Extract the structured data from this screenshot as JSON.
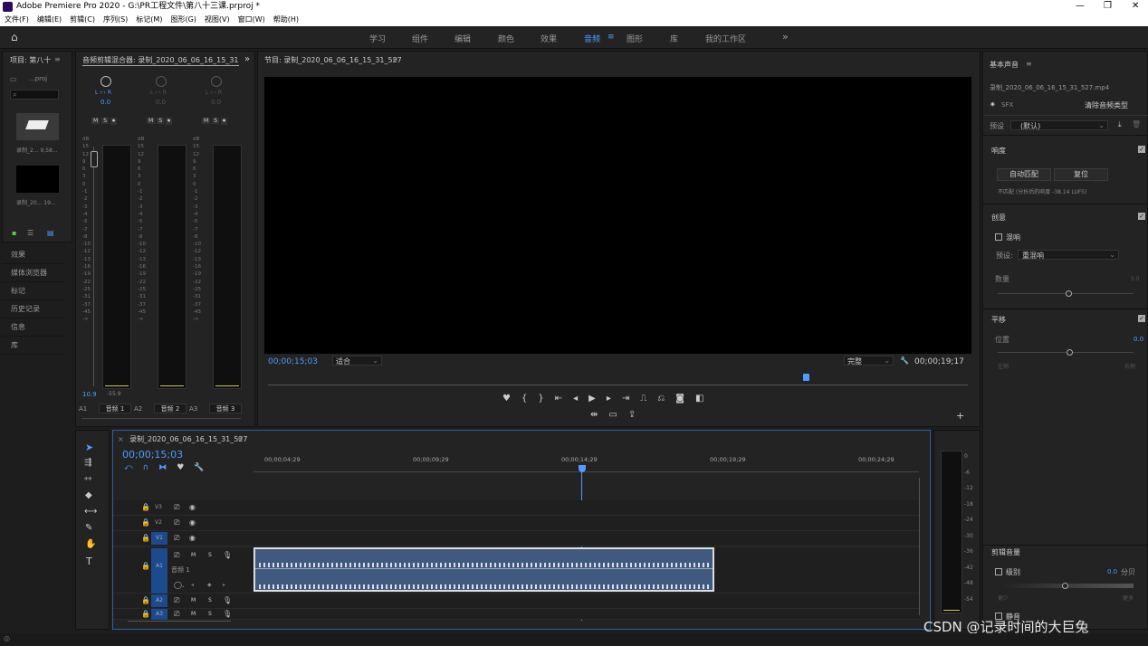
{
  "title": "Adobe Premiere Pro 2020 - G:\\PR工程文件\\第八十三课.prproj *",
  "menu": [
    "文件(F)",
    "编辑(E)",
    "剪辑(C)",
    "序列(S)",
    "标记(M)",
    "图形(G)",
    "视图(V)",
    "窗口(W)",
    "帮助(H)"
  ],
  "workspaces": [
    "学习",
    "组件",
    "编辑",
    "颜色",
    "效果",
    "音频",
    "图形",
    "库",
    "我的工作区"
  ],
  "active_workspace": "音频",
  "project": {
    "title": "项目: 第八十",
    "proj_label": "...proj",
    "items": [
      {
        "name": "录制_2...",
        "size": "9,58..."
      },
      {
        "name": "录制_20...",
        "size": "19..."
      }
    ]
  },
  "left_panels": [
    "效果",
    "媒体浏览器",
    "标记",
    "历史记录",
    "信息",
    "库"
  ],
  "mixer": {
    "title": "音频剪辑混合器: 录制_2020_06_06_16_15_31",
    "channels": [
      {
        "lr": "L",
        "value": "0.0",
        "msb": [
          "M",
          "S",
          "⏺"
        ],
        "label": "音频 1",
        "id": "A1"
      },
      {
        "lr": "L",
        "value": "0.0",
        "msb": [
          "M",
          "S",
          "⏺"
        ],
        "label": "音频 2",
        "id": "A2"
      },
      {
        "lr": "L",
        "value": "0.0",
        "msb": [
          "M",
          "S",
          "⏺"
        ],
        "label": "音频 3",
        "id": "A3"
      }
    ],
    "scale": [
      "dB",
      "15",
      "12",
      "9",
      "6",
      "3",
      "0",
      "-1",
      "-2",
      "-3",
      "-4",
      "-5",
      "-7",
      "-8",
      "-10",
      "-12",
      "-13",
      "-16",
      "-19",
      "-22",
      "-25",
      "-31",
      "-37",
      "-45",
      "-∞"
    ],
    "peak_low": "10.9",
    "peak_val": "-55.9"
  },
  "program": {
    "title": "节目: 录制_2020_06_06_16_15_31_527",
    "timecode": "00;00;15;03",
    "fit": "适合",
    "quality": "完整",
    "duration": "00;00;19;17"
  },
  "timeline": {
    "tab": "录制_2020_06_06_16_15_31_527",
    "timecode": "00;00;15;03",
    "ruler": [
      "00;00;04;29",
      "00;00;09;29",
      "00;00;14;29",
      "00;00;19;29",
      "00;00;24;29"
    ],
    "tracks": [
      "V3",
      "V2",
      "V1",
      "A1",
      "A2",
      "A3"
    ],
    "a1_name": "音频 1"
  },
  "audio_meter_scale": [
    "0",
    "-6",
    "-12",
    "-18",
    "-24",
    "-30",
    "-36",
    "-42",
    "-48",
    "-54"
  ],
  "essential": {
    "title": "基本声音",
    "clip": "录制_2020_06_06_16_15_31_527.mp4",
    "sfx": "SFX",
    "clear": "清除音频类型",
    "preset_label": "预设",
    "preset_value": "(默认)",
    "loudness": "响度",
    "auto_match": "自动匹配",
    "reset": "复位",
    "loud_note": "不匹配 (分析后的响度 -38.14 LUFS)",
    "creative": "创意",
    "reverb": "混响",
    "reverb_preset_label": "预设:",
    "reverb_preset": "重混响",
    "amount": "数量",
    "amount_val": "5.0",
    "pan": "平移",
    "position": "位置",
    "position_val": "0.0",
    "left": "左侧",
    "right": "右侧",
    "clip_volume": "剪辑音量",
    "level": "级别",
    "level_val": "0.0",
    "db": "分贝",
    "minus": "更少",
    "plus": "更多",
    "mute": "静音"
  },
  "watermark": "CSDN @记录时间的大巨兔"
}
